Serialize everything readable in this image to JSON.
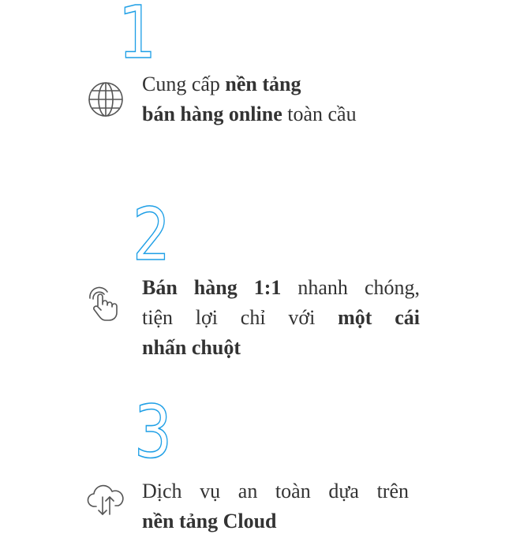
{
  "features": [
    {
      "number": "1",
      "icon": "globe-icon",
      "lines": [
        [
          {
            "text": "Cung cấp ",
            "bold": false
          },
          {
            "text": "nền tảng",
            "bold": true
          }
        ],
        [
          {
            "text": "bán hàng online",
            "bold": true
          },
          {
            "text": " toàn cầu",
            "bold": false
          }
        ]
      ]
    },
    {
      "number": "2",
      "icon": "touch-hand-icon",
      "lines": [
        [
          {
            "text": "Bán hàng 1:1",
            "bold": true
          },
          {
            "text": " nhanh chóng,",
            "bold": false
          }
        ],
        [
          {
            "text": "tiện lợi chỉ với ",
            "bold": false
          },
          {
            "text": "một cái",
            "bold": true
          }
        ],
        [
          {
            "text": "nhấn chuột",
            "bold": true
          }
        ]
      ]
    },
    {
      "number": "3",
      "icon": "cloud-sync-icon",
      "lines": [
        [
          {
            "text": "Dịch vụ an toàn dựa trên",
            "bold": false
          }
        ],
        [
          {
            "text": "nền tảng Cloud",
            "bold": true
          }
        ]
      ]
    }
  ],
  "colors": {
    "accent": "#1e9fe6",
    "text": "#333333",
    "icon": "#555555"
  }
}
